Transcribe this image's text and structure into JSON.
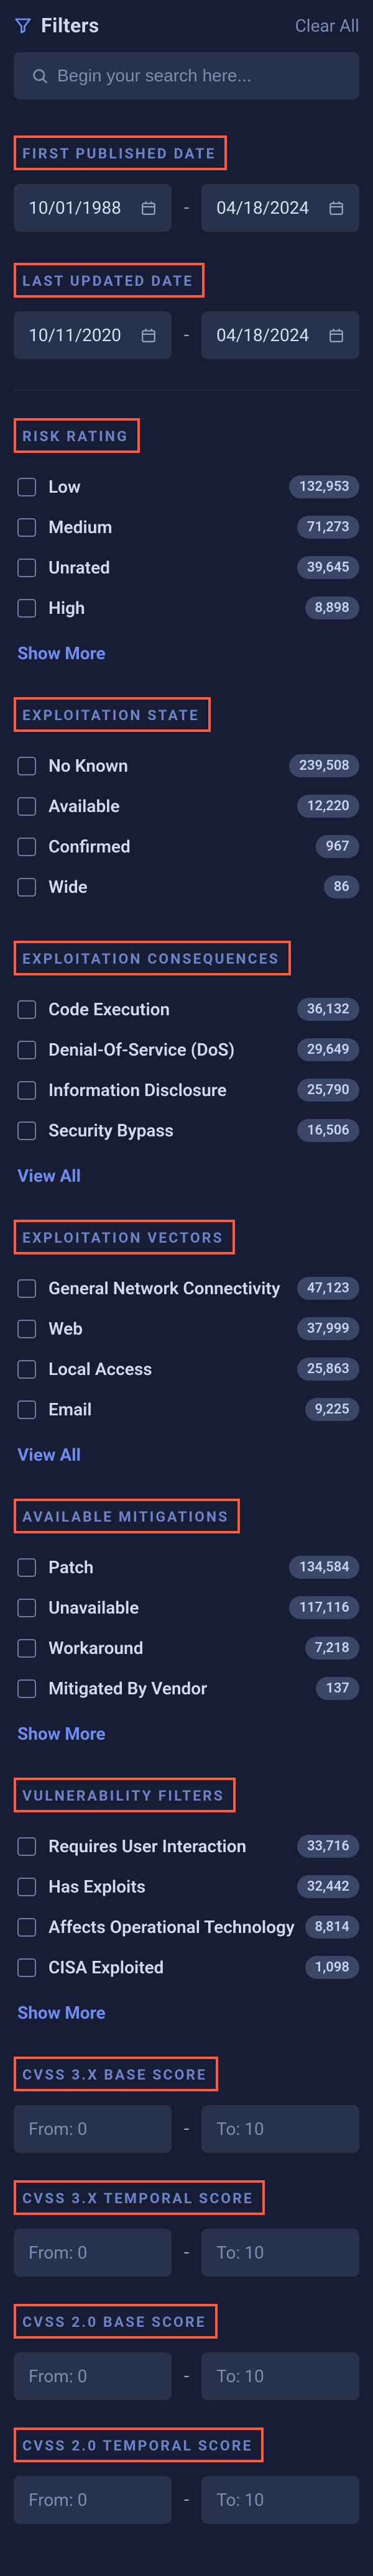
{
  "header": {
    "title": "Filters",
    "clear": "Clear All"
  },
  "search": {
    "placeholder": "Begin your search here..."
  },
  "dates": {
    "first": {
      "label": "FIRST PUBLISHED DATE",
      "from": "10/01/1988",
      "to": "04/18/2024"
    },
    "updated": {
      "label": "LAST UPDATED DATE",
      "from": "10/11/2020",
      "to": "04/18/2024"
    }
  },
  "sections": {
    "risk": {
      "label": "RISK RATING",
      "more": "Show More",
      "items": [
        {
          "label": "Low",
          "count": "132,953"
        },
        {
          "label": "Medium",
          "count": "71,273"
        },
        {
          "label": "Unrated",
          "count": "39,645"
        },
        {
          "label": "High",
          "count": "8,898"
        }
      ]
    },
    "expl_state": {
      "label": "EXPLOITATION STATE",
      "more": null,
      "items": [
        {
          "label": "No Known",
          "count": "239,508"
        },
        {
          "label": "Available",
          "count": "12,220"
        },
        {
          "label": "Confirmed",
          "count": "967"
        },
        {
          "label": "Wide",
          "count": "86"
        }
      ]
    },
    "expl_cons": {
      "label": "EXPLOITATION CONSEQUENCES",
      "more": "View All",
      "items": [
        {
          "label": "Code Execution",
          "count": "36,132"
        },
        {
          "label": "Denial-Of-Service (DoS)",
          "count": "29,649"
        },
        {
          "label": "Information Disclosure",
          "count": "25,790"
        },
        {
          "label": "Security Bypass",
          "count": "16,506"
        }
      ]
    },
    "expl_vec": {
      "label": "EXPLOITATION VECTORS",
      "more": "View All",
      "items": [
        {
          "label": "General Network Connectivity",
          "count": "47,123"
        },
        {
          "label": "Web",
          "count": "37,999"
        },
        {
          "label": "Local Access",
          "count": "25,863"
        },
        {
          "label": "Email",
          "count": "9,225"
        }
      ]
    },
    "mitig": {
      "label": "AVAILABLE MITIGATIONS",
      "more": "Show More",
      "items": [
        {
          "label": "Patch",
          "count": "134,584"
        },
        {
          "label": "Unavailable",
          "count": "117,116"
        },
        {
          "label": "Workaround",
          "count": "7,218"
        },
        {
          "label": "Mitigated By Vendor",
          "count": "137"
        }
      ]
    },
    "vuln": {
      "label": "VULNERABILITY FILTERS",
      "more": "Show More",
      "items": [
        {
          "label": "Requires User Interaction",
          "count": "33,716"
        },
        {
          "label": "Has Exploits",
          "count": "32,442"
        },
        {
          "label": "Affects Operational Technology",
          "count": "8,814"
        },
        {
          "label": "CISA Exploited",
          "count": "1,098"
        }
      ]
    }
  },
  "scores": {
    "cvss3_base": {
      "label": "CVSS 3.X BASE SCORE",
      "from": "From: 0",
      "to": "To: 10"
    },
    "cvss3_temp": {
      "label": "CVSS 3.X TEMPORAL SCORE",
      "from": "From: 0",
      "to": "To: 10"
    },
    "cvss2_base": {
      "label": "CVSS 2.0 BASE SCORE",
      "from": "From: 0",
      "to": "To: 10"
    },
    "cvss2_temp": {
      "label": "CVSS 2.0 TEMPORAL SCORE",
      "from": "From: 0",
      "to": "To: 10"
    }
  },
  "sep": "-"
}
